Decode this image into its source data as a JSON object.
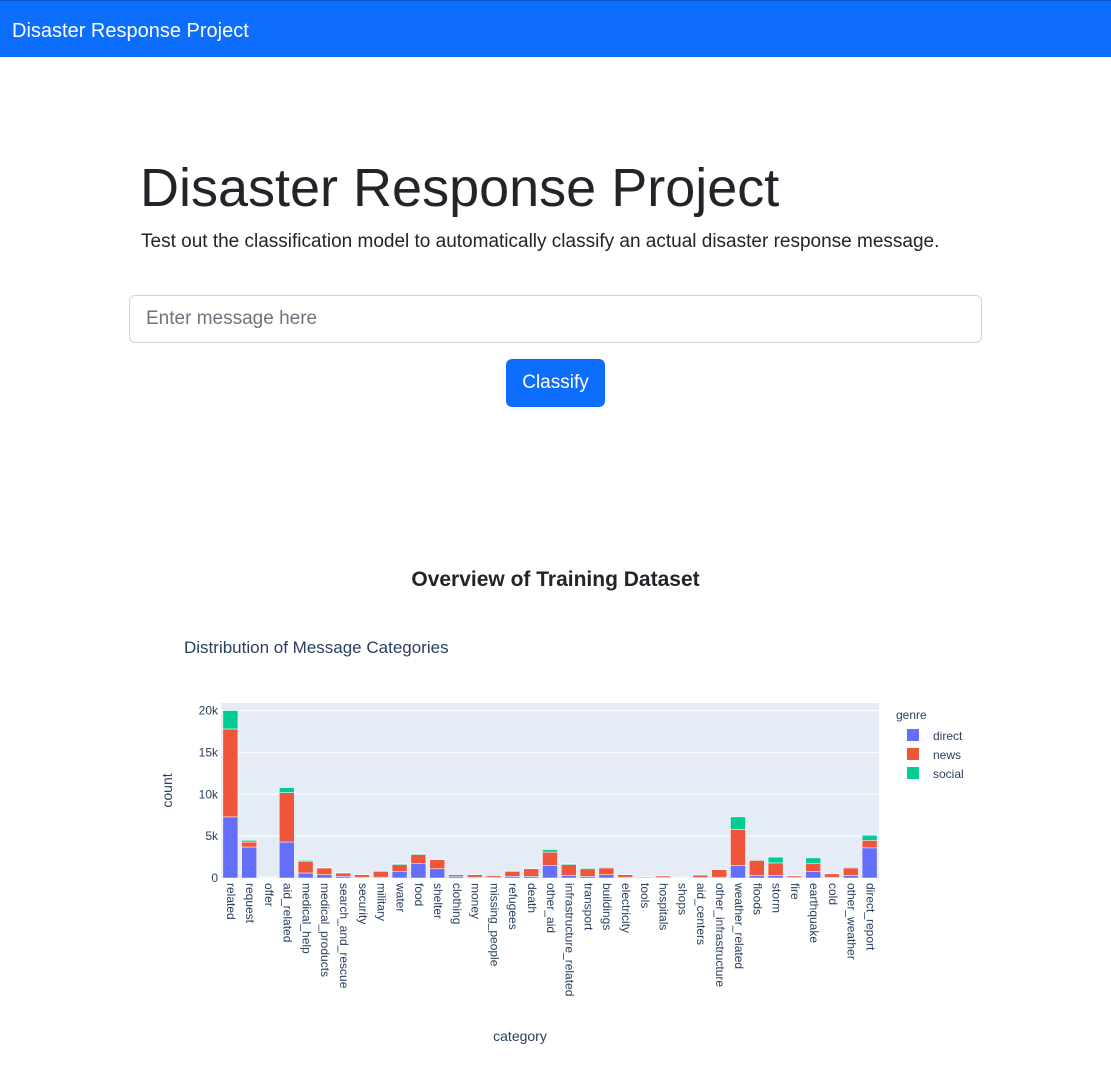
{
  "navbar": {
    "brand": "Disaster Response Project"
  },
  "hero": {
    "title": "Disaster Response Project",
    "subtitle": "Test out the classification model to automatically classify an actual disaster response message."
  },
  "form": {
    "placeholder": "Enter message here",
    "button_label": "Classify"
  },
  "section_title": "Overview of Training Dataset",
  "colors": {
    "direct": "#636efa",
    "news": "#ef553b",
    "social": "#00cc96",
    "accent": "#0d6efd"
  },
  "chart_data": {
    "type": "bar",
    "stacked": true,
    "title": "Distribution of Message Categories",
    "xlabel": "category",
    "ylabel": "count",
    "ylim": [
      0,
      20900
    ],
    "yticks": [
      0,
      5000,
      10000,
      15000,
      20000
    ],
    "ytick_labels": [
      "0",
      "5k",
      "10k",
      "15k",
      "20k"
    ],
    "legend_title": "genre",
    "legend_position": "top-right",
    "categories": [
      "related",
      "request",
      "offer",
      "aid_related",
      "medical_help",
      "medical_products",
      "search_and_rescue",
      "security",
      "military",
      "water",
      "food",
      "shelter",
      "clothing",
      "money",
      "missing_people",
      "refugees",
      "death",
      "other_aid",
      "infrastructure_related",
      "transport",
      "buildings",
      "electricity",
      "tools",
      "hospitals",
      "shops",
      "aid_centers",
      "other_infrastructure",
      "weather_related",
      "floods",
      "storm",
      "fire",
      "earthquake",
      "cold",
      "other_weather",
      "direct_report"
    ],
    "series": [
      {
        "name": "direct",
        "values": [
          7300,
          3700,
          50,
          4300,
          600,
          400,
          200,
          100,
          100,
          800,
          1700,
          1100,
          200,
          100,
          100,
          200,
          200,
          1500,
          300,
          200,
          400,
          100,
          50,
          50,
          50,
          50,
          100,
          1500,
          300,
          300,
          50,
          800,
          100,
          300,
          3600
        ]
      },
      {
        "name": "news",
        "values": [
          10500,
          600,
          50,
          5900,
          1400,
          800,
          400,
          300,
          700,
          800,
          1100,
          1100,
          200,
          300,
          200,
          600,
          900,
          1600,
          1300,
          900,
          800,
          300,
          100,
          200,
          50,
          300,
          900,
          4300,
          1800,
          1500,
          200,
          900,
          400,
          900,
          900
        ]
      },
      {
        "name": "social",
        "values": [
          2200,
          200,
          20,
          600,
          100,
          50,
          50,
          20,
          20,
          100,
          100,
          50,
          20,
          20,
          20,
          50,
          20,
          300,
          100,
          100,
          100,
          20,
          20,
          20,
          20,
          20,
          20,
          1500,
          100,
          700,
          50,
          700,
          20,
          100,
          600
        ]
      }
    ]
  }
}
